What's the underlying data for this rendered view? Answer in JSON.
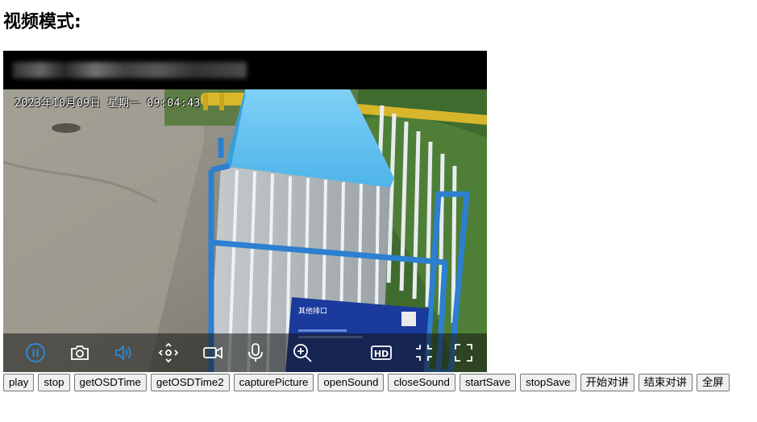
{
  "page": {
    "title": "视频模式:"
  },
  "player": {
    "osd_text": "2023年10月09日 星期一 09:04:43",
    "sign_title": "其他排口",
    "accent_color": "#2b8ad8",
    "controls": [
      {
        "name": "pause-icon"
      },
      {
        "name": "camera-icon"
      },
      {
        "name": "volume-icon"
      },
      {
        "name": "ptz-control-icon"
      },
      {
        "name": "record-video-icon"
      },
      {
        "name": "microphone-icon"
      },
      {
        "name": "zoom-in-icon"
      },
      {
        "name": "hd-label",
        "text": "HD"
      },
      {
        "name": "exit-fullscreen-icon"
      },
      {
        "name": "fullscreen-icon"
      }
    ]
  },
  "buttons": [
    "play",
    "stop",
    "getOSDTime",
    "getOSDTime2",
    "capturePicture",
    "openSound",
    "closeSound",
    "startSave",
    "stopSave",
    "开始对讲",
    "结束对讲",
    "全屏"
  ]
}
